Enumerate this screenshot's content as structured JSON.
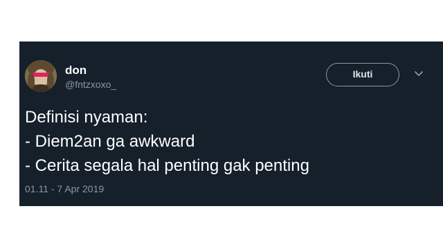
{
  "tweet": {
    "author_name": "don",
    "author_handle": "@fntzxoxo_",
    "follow_label": "Ikuti",
    "menu_icon": "chevron-down-icon",
    "avatar_icon": "avatar-icon",
    "body_lines": [
      "Definisi nyaman:",
      "- Diem2an ga awkward",
      "- Cerita segala hal penting gak penting"
    ],
    "timestamp": "01.11 - 7 Apr 2019"
  },
  "colors": {
    "card_background": "#15202b",
    "text_primary": "#ffffff",
    "text_secondary": "#8899a6",
    "button_border": "#8899a6",
    "page_background": "#ffffff"
  }
}
